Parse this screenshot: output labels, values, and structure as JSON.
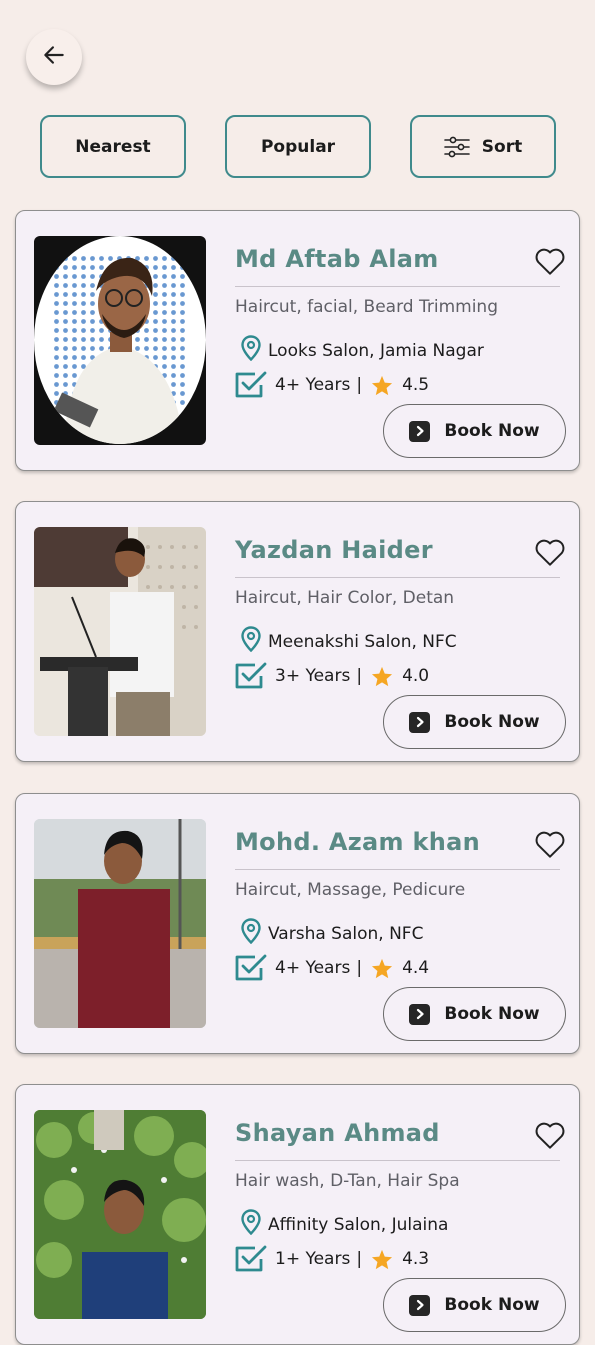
{
  "filters": [
    {
      "label": "Nearest"
    },
    {
      "label": "Popular"
    },
    {
      "label": "Sort",
      "icon": "sliders-icon"
    }
  ],
  "book_label": "Book Now",
  "colors": {
    "accent": "#2e8a8f",
    "name": "#5a8a85",
    "star": "#f5a623",
    "background": "#f6ede9",
    "card": "#f5f0f7"
  },
  "stylists": [
    {
      "name": "Md Aftab Alam",
      "services": "Haircut, facial, Beard Trimming",
      "location": "Looks Salon, Jamia Nagar",
      "experience": "4+ Years",
      "separator": "|",
      "rating": "4.5"
    },
    {
      "name": "Yazdan Haider",
      "services": "Haircut, Hair Color, Detan",
      "location": "Meenakshi Salon, NFC",
      "experience": "3+ Years",
      "separator": "|",
      "rating": "4.0"
    },
    {
      "name": "Mohd. Azam khan",
      "services": "Haircut, Massage, Pedicure",
      "location": "Varsha Salon, NFC",
      "experience": "4+ Years",
      "separator": "|",
      "rating": "4.4"
    },
    {
      "name": "Shayan Ahmad",
      "services": "Hair wash, D-Tan, Hair Spa",
      "location": "Affinity Salon, Julaina",
      "experience": "1+ Years",
      "separator": "|",
      "rating": "4.3"
    }
  ]
}
